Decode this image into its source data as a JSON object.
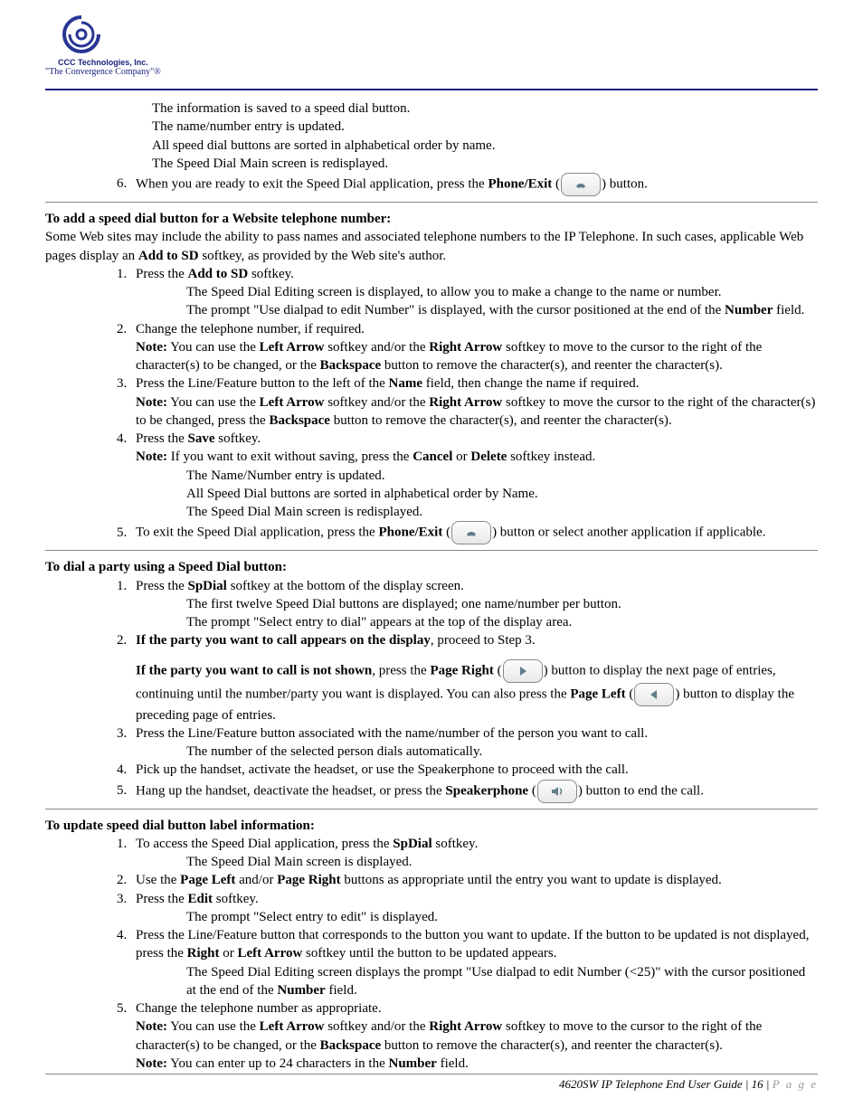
{
  "logo": {
    "name": "CCC Technologies, Inc.",
    "tagline": "\"The Convergence Company\"®"
  },
  "intro_sub": [
    "The information is saved to a speed dial button.",
    "The name/number entry is updated.",
    "All speed dial buttons are sorted in alphabetical order by name.",
    "The Speed Dial Main screen is redisplayed."
  ],
  "intro_step6_a": "When you are ready to exit the Speed Dial application, press the ",
  "intro_step6_b": "Phone/Exit",
  "intro_step6_c": " (",
  "intro_step6_d": ") button.",
  "secA_head": "To add a speed dial button for a Website telephone number:",
  "secA_intro_a": "Some Web sites may include the ability to pass names and associated telephone numbers to the IP Telephone. In such cases, applicable Web pages display an ",
  "secA_intro_b": "Add to SD",
  "secA_intro_c": " softkey, as provided by the Web site's author.",
  "a1_a": "Press the ",
  "a1_b": "Add to SD",
  "a1_c": " softkey.",
  "a1_sub1": "The Speed Dial Editing screen is displayed, to allow you to make a change to the name or number.",
  "a1_sub2_a": "The prompt \"Use dialpad to edit Number\" is displayed, with the cursor positioned at the end of the ",
  "a1_sub2_b": "Number",
  "a1_sub2_c": " field.",
  "a2": "Change the telephone number, if required.",
  "a2_note_a": "Note:",
  "a2_note_b": " You can use the ",
  "a2_note_c": "Left Arrow",
  "a2_note_d": " softkey and/or the ",
  "a2_note_e": "Right Arrow",
  "a2_note_f": " softkey to move to the cursor to the right of the character(s) to be changed, or the ",
  "a2_note_g": "Backspace",
  "a2_note_h": " button to remove the character(s), and reenter the character(s).",
  "a3_a": "Press the Line/Feature button to the left of the ",
  "a3_b": "Name",
  "a3_c": " field, then change the name if required.",
  "a3_note_a": "Note:",
  "a3_note_b": " You can use the ",
  "a3_note_c": "Left Arrow",
  "a3_note_d": " softkey and/or the ",
  "a3_note_e": "Right Arrow",
  "a3_note_f": " softkey to move the cursor to the right of the character(s) to be changed, press the ",
  "a3_note_g": "Backspace",
  "a3_note_h": " button to remove the character(s), and reenter the character(s).",
  "a4_a": "Press the ",
  "a4_b": "Save",
  "a4_c": " softkey.",
  "a4_note_a": "Note:",
  "a4_note_b": " If you want to exit without saving, press the ",
  "a4_note_c": "Cancel",
  "a4_note_d": " or ",
  "a4_note_e": "Delete",
  "a4_note_f": " softkey instead.",
  "a4_sub1": "The Name/Number entry is updated.",
  "a4_sub2": "All Speed Dial buttons are sorted in alphabetical order by Name.",
  "a4_sub3": "The Speed Dial Main screen is redisplayed.",
  "a5_a": "To exit the Speed Dial application, press the ",
  "a5_b": "Phone/Exit",
  "a5_c": " (",
  "a5_d": ") button or select another application if applicable.",
  "secB_head": "To dial a party using a Speed Dial button:",
  "b1_a": "Press the ",
  "b1_b": "SpDial",
  "b1_c": " softkey at the bottom of the display screen.",
  "b1_sub1": "The first twelve Speed Dial buttons are displayed; one name/number per button.",
  "b1_sub2": "The prompt \"Select entry to dial\" appears at the top of the display area.",
  "b2_a": "If the party you want to call appears on the display",
  "b2_b": ", proceed to Step 3.",
  "b2p2_a": "If the party you want to call is not shown",
  "b2p2_b": ", press the ",
  "b2p2_c": "Page Right",
  "b2p2_d": " (",
  "b2p2_e": ") button to display the next page of entries, continuing until the number/party you want is displayed. You can also press the ",
  "b2p2_f": "Page Left",
  "b2p2_g": " (",
  "b2p2_h": ") button to display the preceding page of entries.",
  "b3": "Press the Line/Feature button associated with the name/number of the person you want to call.",
  "b3_sub": "The number of the selected person dials automatically.",
  "b4": "Pick up the handset, activate the headset, or use the Speakerphone to proceed with the call.",
  "b5_a": "Hang up the handset, deactivate the headset, or press the ",
  "b5_b": "Speakerphone",
  "b5_c": " (",
  "b5_d": ") button to end the call.",
  "secC_head": "To update speed dial button label information:",
  "c1_a": "To access the Speed Dial application, press the ",
  "c1_b": "SpDial",
  "c1_c": " softkey.",
  "c1_sub": "The Speed Dial Main screen is displayed.",
  "c2_a": "Use the ",
  "c2_b": "Page Left",
  "c2_c": " and/or ",
  "c2_d": "Page Right",
  "c2_e": " buttons as appropriate until the entry you want to update is displayed.",
  "c3_a": "Press the ",
  "c3_b": "Edit",
  "c3_c": " softkey.",
  "c3_sub": "The prompt \"Select entry to edit\" is displayed.",
  "c4_a": "Press the Line/Feature button that corresponds to the button you want to update. If the button to be updated is not displayed, press the ",
  "c4_b": "Right",
  "c4_c": " or ",
  "c4_d": "Left Arrow",
  "c4_e": " softkey until the button to be updated appears.",
  "c4_sub_a": "The Speed Dial Editing screen displays the prompt \"Use dialpad to edit Number (<25)\" with the cursor positioned at the end of the ",
  "c4_sub_b": "Number",
  "c4_sub_c": " field.",
  "c5": "Change the telephone number as appropriate.",
  "c5_note1_a": "Note:",
  "c5_note1_b": " You can use the ",
  "c5_note1_c": "Left Arrow",
  "c5_note1_d": " softkey and/or the ",
  "c5_note1_e": "Right Arrow",
  "c5_note1_f": " softkey to move to the cursor to the right of the character(s) to be changed, or the ",
  "c5_note1_g": "Backspace",
  "c5_note1_h": " button to remove the character(s), and reenter the character(s).",
  "c5_note2_a": "Note:",
  "c5_note2_b": " You can enter up to 24 characters in the ",
  "c5_note2_c": "Number",
  "c5_note2_d": " field.",
  "footer_a": "4620SW IP Telephone End User Guide | 16 | ",
  "footer_b": "P a g e"
}
